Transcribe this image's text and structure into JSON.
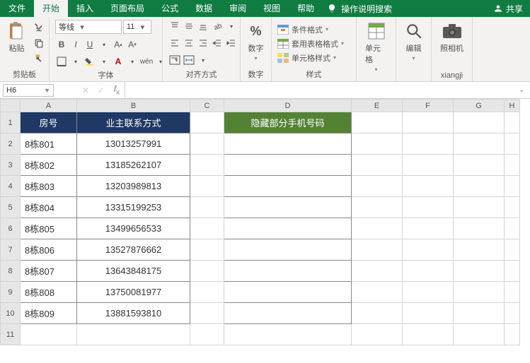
{
  "tabs": {
    "file": "文件",
    "home": "开始",
    "insert": "插入",
    "layout": "页面布局",
    "formulas": "公式",
    "data": "数据",
    "review": "审阅",
    "view": "视图",
    "help": "帮助",
    "tell_me": "操作说明搜索",
    "share": "共享"
  },
  "ribbon": {
    "clipboard": {
      "paste": "粘贴",
      "label": "剪贴板"
    },
    "font": {
      "name": "等线",
      "size": "11",
      "label": "字体"
    },
    "align": {
      "label": "对齐方式"
    },
    "number": {
      "btn": "数字",
      "label": "数字"
    },
    "styles": {
      "cond": "条件格式",
      "table": "套用表格格式",
      "cell": "单元格样式",
      "label": "样式"
    },
    "cells": {
      "btn": "单元格"
    },
    "editing": {
      "btn": "编辑"
    },
    "camera": {
      "btn": "照相机",
      "label": "xiangji"
    }
  },
  "formula_bar": {
    "cell_ref": "H6",
    "formula": ""
  },
  "cols": [
    "A",
    "B",
    "C",
    "D",
    "E",
    "F",
    "G",
    "H"
  ],
  "rows": [
    "1",
    "2",
    "3",
    "4",
    "5",
    "6",
    "7",
    "8",
    "9",
    "10",
    "11"
  ],
  "headers": {
    "a": "房号",
    "b": "业主联系方式",
    "d": "隐藏部分手机号码"
  },
  "data": [
    {
      "a": "8栋801",
      "b": "13013257991"
    },
    {
      "a": "8栋802",
      "b": "13185262107"
    },
    {
      "a": "8栋803",
      "b": "13203989813"
    },
    {
      "a": "8栋804",
      "b": "13315199253"
    },
    {
      "a": "8栋805",
      "b": "13499656533"
    },
    {
      "a": "8栋806",
      "b": "13527876662"
    },
    {
      "a": "8栋807",
      "b": "13643848175"
    },
    {
      "a": "8栋808",
      "b": "13750081977"
    },
    {
      "a": "8栋809",
      "b": "13881593810"
    }
  ],
  "col_widths": {
    "A": 80,
    "B": 160,
    "C": 48,
    "D": 180,
    "E": 72,
    "F": 72,
    "G": 72,
    "H": 22
  }
}
